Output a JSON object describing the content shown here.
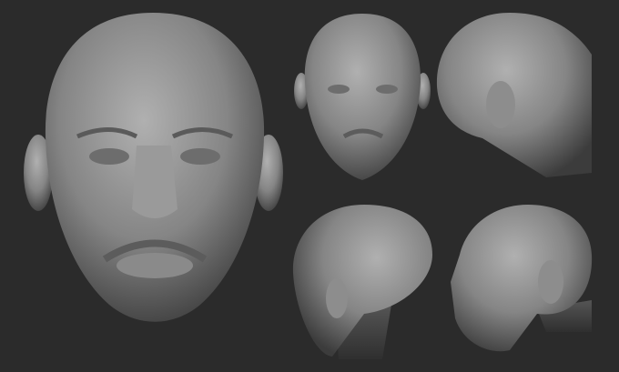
{
  "scene": {
    "background_color": "#2b2b2b",
    "clay_light": "#a8a8a8",
    "clay_mid": "#7a7a7a",
    "clay_dark": "#3a3a3a",
    "views": [
      "front-large",
      "front-small",
      "back-right-three-quarter",
      "back-left-three-quarter",
      "right-profile"
    ]
  }
}
